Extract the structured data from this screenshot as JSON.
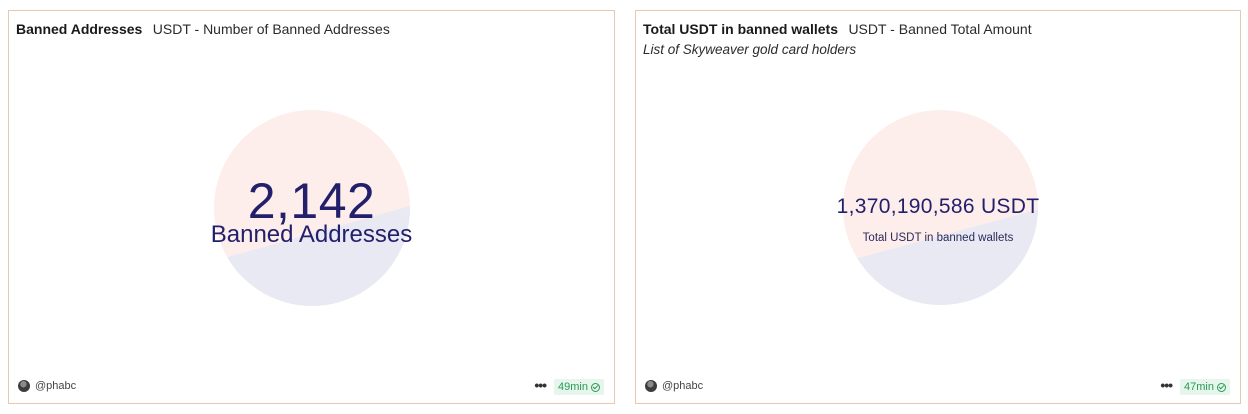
{
  "colors": {
    "pie_top": "#fdeeec",
    "pie_bottom": "#e9e9f3",
    "value_text": "#23206b",
    "badge_bg": "#e6f6ec",
    "badge_text": "#2a9a55",
    "card_border": "#e6c9b0"
  },
  "cards": [
    {
      "title": "Banned Addresses",
      "subtitle": "USDT - Number of Banned Addresses",
      "counter_value": "2,142",
      "counter_label": "Banned Addresses",
      "author": "@phabc",
      "refresh": "49min",
      "icons": [
        "avatar",
        "more-icon",
        "check-circle-icon"
      ]
    },
    {
      "title": "Total USDT in banned wallets",
      "subtitle": "USDT - Banned Total Amount",
      "description": "List of Skyweaver gold card holders",
      "counter_value": "1,370,190,586 USDT",
      "counter_label": "Total USDT in banned wallets",
      "author": "@phabc",
      "refresh": "47min",
      "icons": [
        "avatar",
        "more-icon",
        "check-circle-icon"
      ]
    }
  ]
}
